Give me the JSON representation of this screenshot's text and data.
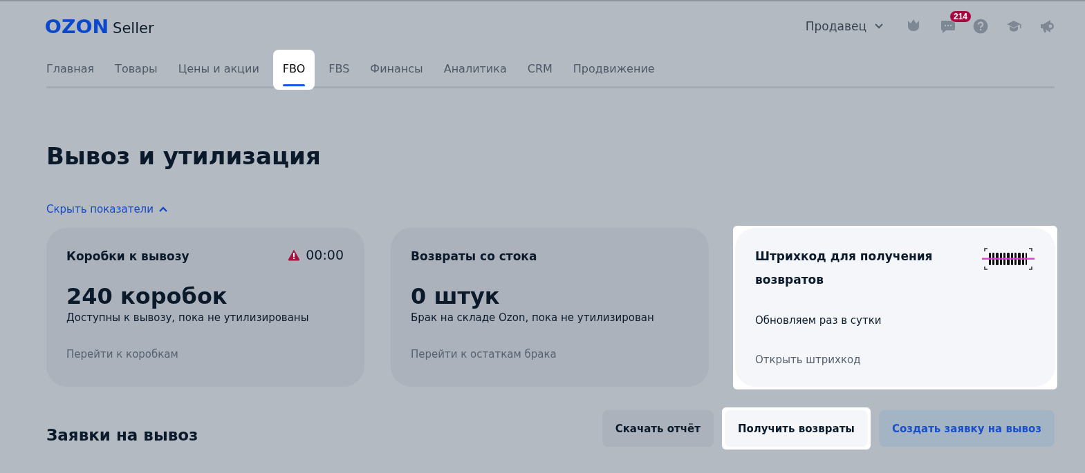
{
  "header": {
    "logo": "OZON",
    "logo_suffix": "Seller",
    "role_menu": "Продавец",
    "icons": [
      {
        "kind": "crown"
      },
      {
        "kind": "chat",
        "badge": "214"
      },
      {
        "kind": "help"
      },
      {
        "kind": "cap"
      },
      {
        "kind": "megaphone"
      }
    ]
  },
  "tabs": [
    {
      "label": "Главная",
      "selected": false,
      "highlighted": false
    },
    {
      "label": "Товары",
      "selected": false,
      "highlighted": false
    },
    {
      "label": "Цены и акции",
      "selected": false,
      "highlighted": false
    },
    {
      "label": "FBO",
      "selected": true,
      "highlighted": true
    },
    {
      "label": "FBS",
      "selected": false,
      "highlighted": false
    },
    {
      "label": "Финансы",
      "selected": false,
      "highlighted": false
    },
    {
      "label": "Аналитика",
      "selected": false,
      "highlighted": false
    },
    {
      "label": "CRM",
      "selected": false,
      "highlighted": false
    },
    {
      "label": "Продвижение",
      "selected": false,
      "highlighted": false
    }
  ],
  "page_title": "Вывоз и утилизация",
  "toggle_metrics": "Скрыть показатели",
  "cards": [
    {
      "kind": "counter",
      "title": "Коробки к вывозу",
      "timer": "00:00",
      "value": "240 коробок",
      "description": "Доступны к вывозу, пока не утилизированы",
      "link": "Перейти к коробкам",
      "highlighted": false
    },
    {
      "kind": "counter",
      "title": "Возвраты со стока",
      "value": "0 штук",
      "description": "Брак на складе Ozon, пока не утилизирован",
      "link": "Перейти к остаткам брака",
      "highlighted": false
    },
    {
      "kind": "barcode",
      "title": "Штрихкод для получения возвратов",
      "description": "Обновляем раз в сутки",
      "link": "Открыть штрихкод",
      "highlighted": true
    }
  ],
  "section_title": "Заявки на вывоз",
  "buttons": [
    {
      "label": "Скачать отчёт",
      "kind": "secondary",
      "highlighted": false
    },
    {
      "label": "Получить возвраты",
      "kind": "secondary",
      "highlighted": true
    },
    {
      "label": "Создать заявку на вывоз",
      "kind": "accent",
      "highlighted": false
    }
  ]
}
